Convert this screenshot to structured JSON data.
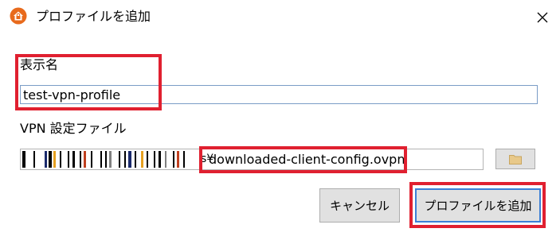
{
  "window": {
    "title": "プロファイルを追加",
    "app_icon": "home-lock-icon",
    "close_icon": "close-icon",
    "accent_color": "#e86a1c"
  },
  "form": {
    "display_name_label": "表示名",
    "display_name_value": "test-vpn-profile",
    "vpn_file_label": "VPN 設定ファイル",
    "vpn_file_separator": "s¥",
    "vpn_file_name": "downloaded-client-config.ovpn",
    "browse_icon": "folder-icon"
  },
  "buttons": {
    "cancel_label": "キャンセル",
    "add_label": "プロファイルを追加"
  },
  "annotations": {
    "highlight_color": "#e02030"
  }
}
